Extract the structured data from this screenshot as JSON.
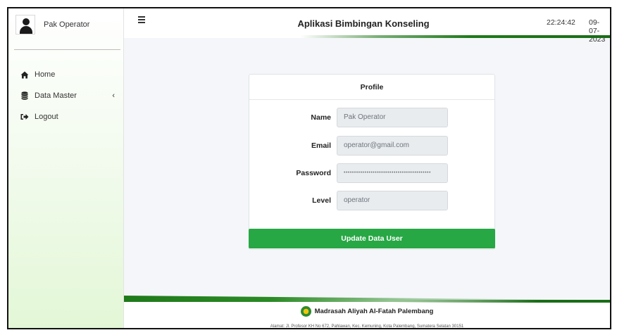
{
  "sidebar": {
    "user_name": "Pak Operator",
    "items": [
      {
        "label": "Home",
        "icon": "home-icon"
      },
      {
        "label": "Data Master",
        "icon": "database-icon",
        "chevron": "‹"
      },
      {
        "label": "Logout",
        "icon": "logout-icon"
      }
    ]
  },
  "topbar": {
    "title": "Aplikasi Bimbingan Konseling",
    "time": "22:24:42",
    "date": "09-07-2023"
  },
  "profile": {
    "header": "Profile",
    "fields": [
      {
        "label": "Name",
        "value": "Pak Operator"
      },
      {
        "label": "Email",
        "value": "operator@gmail.com"
      },
      {
        "label": "Password",
        "value": "••••••••••••••••••••••••••••••••••••••••••"
      },
      {
        "label": "Level",
        "value": "operator"
      }
    ],
    "button_label": "Update Data User"
  },
  "footer": {
    "school_name": "Madrasah Aliyah Al-Fatah Palembang",
    "address": "Alamat: Jl. Profesor KH No 672, Pahlawan, Kec. Kemuning, Kota Palembang, Sumatera Selatan 30151"
  },
  "colors": {
    "accent_green": "#28a745",
    "brand_green": "#1f7a1a"
  }
}
